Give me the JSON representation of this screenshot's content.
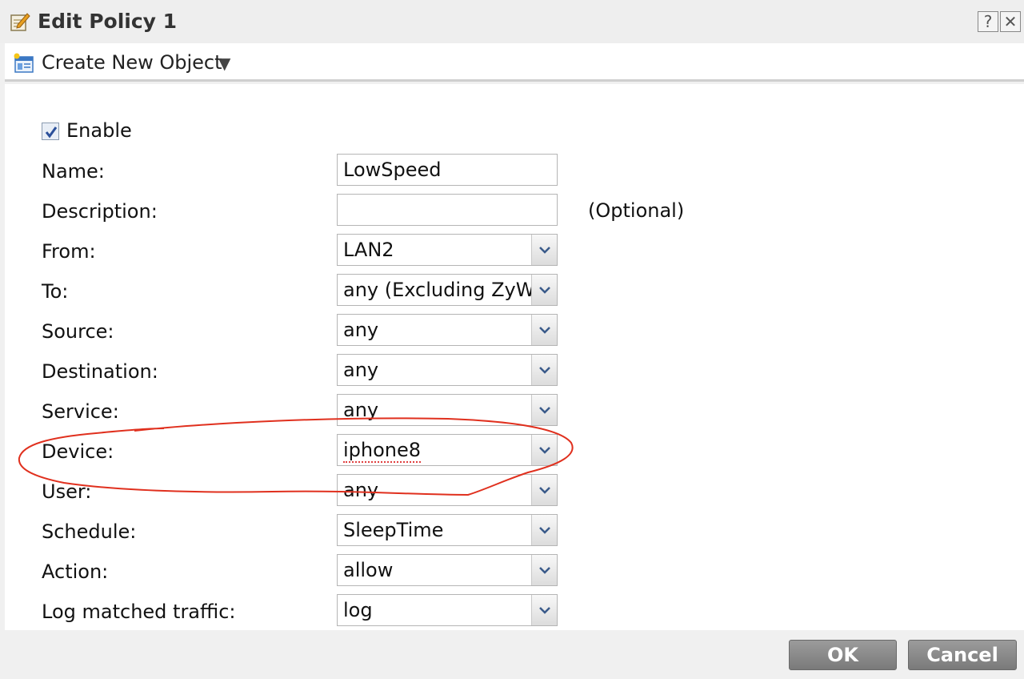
{
  "window": {
    "title": "Edit Policy 1",
    "help_label": "?",
    "close_label": "✕"
  },
  "toolbar": {
    "create_label": "Create New Object",
    "caret": "▼"
  },
  "form": {
    "enable": {
      "label": "Enable",
      "checked": true
    },
    "name": {
      "label": "Name:",
      "value": "LowSpeed"
    },
    "description": {
      "label": "Description:",
      "value": "",
      "hint": "(Optional)"
    },
    "from": {
      "label": "From:",
      "value": "LAN2"
    },
    "to": {
      "label": "To:",
      "value": "any (Excluding ZyWALL)"
    },
    "source": {
      "label": "Source:",
      "value": "any"
    },
    "destination": {
      "label": "Destination:",
      "value": "any"
    },
    "service": {
      "label": "Service:",
      "value": "any"
    },
    "device": {
      "label": "Device:",
      "value": "iphone8"
    },
    "user": {
      "label": "User:",
      "value": "any"
    },
    "schedule": {
      "label": "Schedule:",
      "value": "SleepTime"
    },
    "action": {
      "label": "Action:",
      "value": "allow"
    },
    "log": {
      "label": "Log matched traffic:",
      "value": "log"
    }
  },
  "footer": {
    "ok_label": "OK",
    "cancel_label": "Cancel"
  },
  "colors": {
    "annotation": "#e0301e",
    "button": "#888888"
  }
}
